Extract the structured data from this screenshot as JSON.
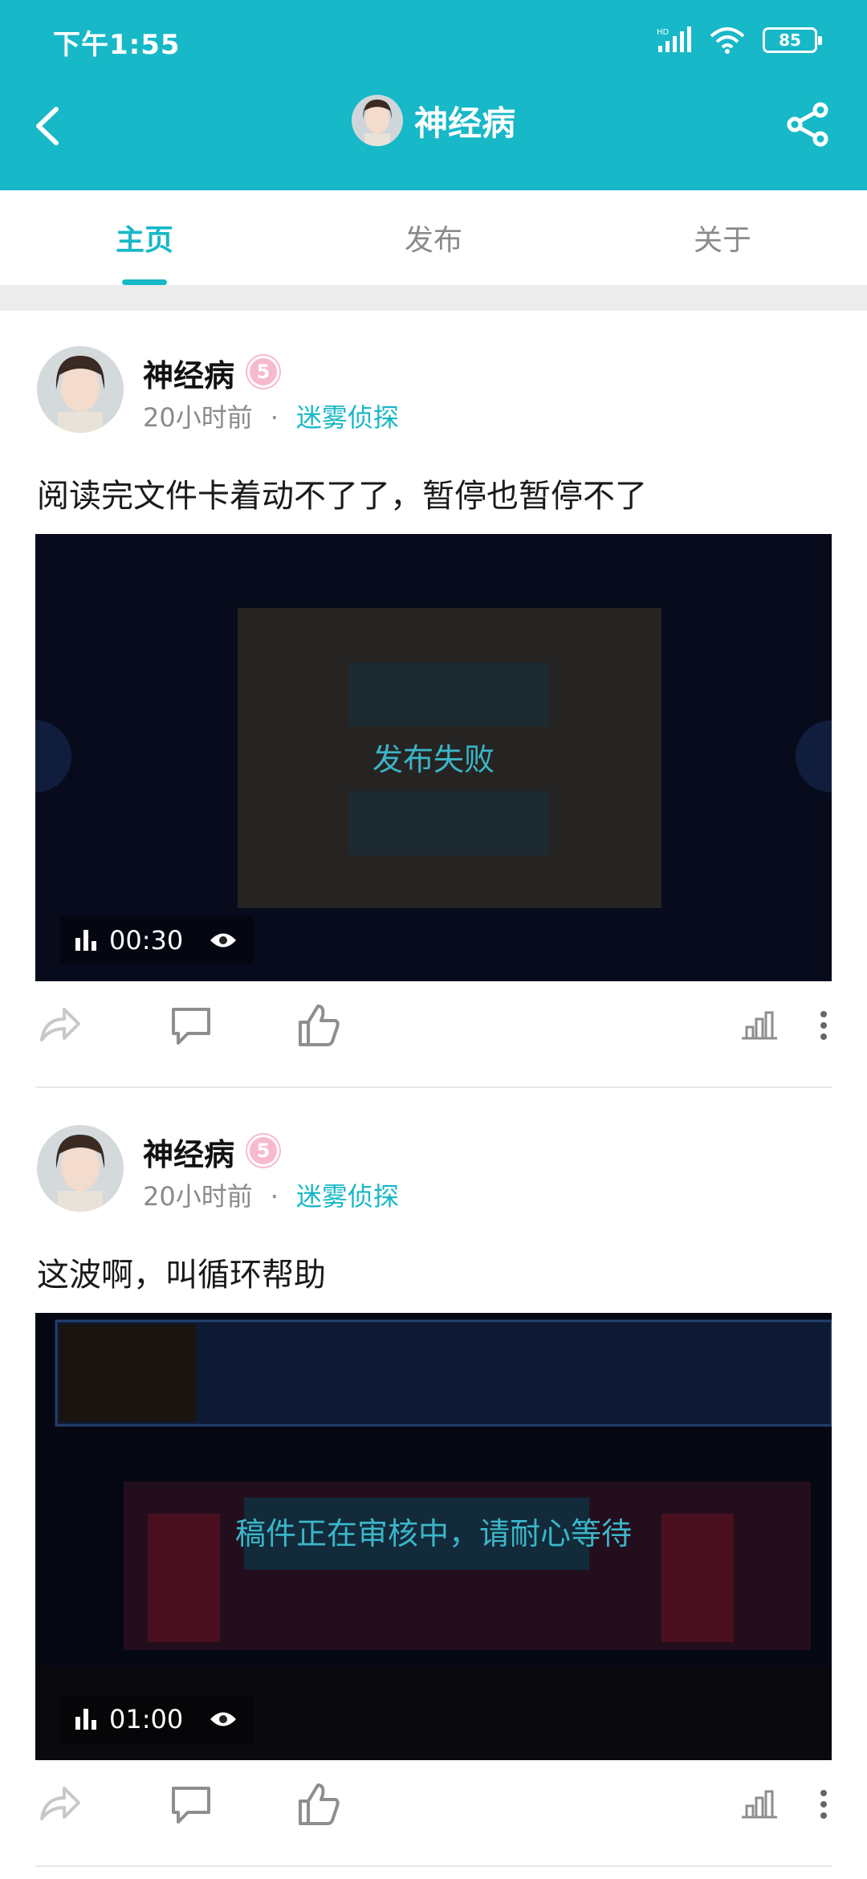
{
  "status_bar": {
    "time": "下午1:55",
    "battery": "85"
  },
  "header": {
    "title": "神经病"
  },
  "tabs": [
    {
      "label": "主页",
      "active": true
    },
    {
      "label": "发布",
      "active": false
    },
    {
      "label": "关于",
      "active": false
    }
  ],
  "posts": [
    {
      "author": "神经病",
      "level": "5",
      "time": "20小时前",
      "separator": "·",
      "game": "迷雾侦探",
      "text": "阅读完文件卡着动不了了，暂停也暂停不了",
      "video_status": "发布失败",
      "duration": "00:30"
    },
    {
      "author": "神经病",
      "level": "5",
      "time": "20小时前",
      "separator": "·",
      "game": "迷雾侦探",
      "text": "这波啊，叫循环帮助",
      "video_status": "稿件正在审核中，请耐心等待",
      "duration": "01:00"
    }
  ],
  "colors": {
    "accent": "#17b8c7",
    "badge": "#f7b9d0"
  }
}
